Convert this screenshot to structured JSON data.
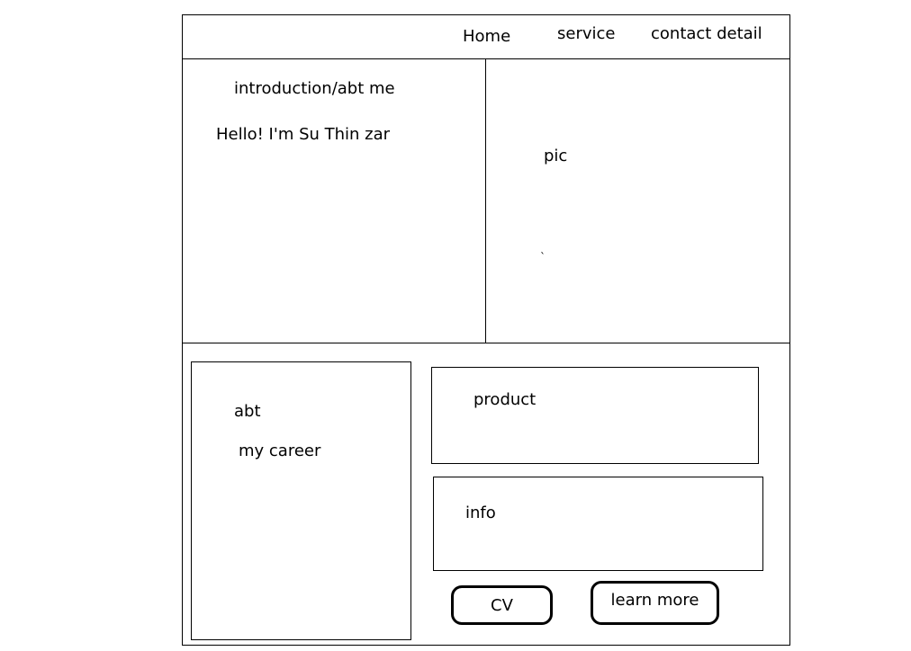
{
  "nav": {
    "home": "Home",
    "service": "service",
    "contact": "contact detail"
  },
  "hero": {
    "heading": "introduction/abt me",
    "greeting": "Hello! I'm Su Thin zar",
    "pic_label": "pic",
    "stray_mark": "`"
  },
  "career": {
    "line1": "abt",
    "line2": "my career"
  },
  "product": {
    "label": "product"
  },
  "info": {
    "label": "info"
  },
  "buttons": {
    "cv": "CV",
    "learn_more": "learn more"
  }
}
